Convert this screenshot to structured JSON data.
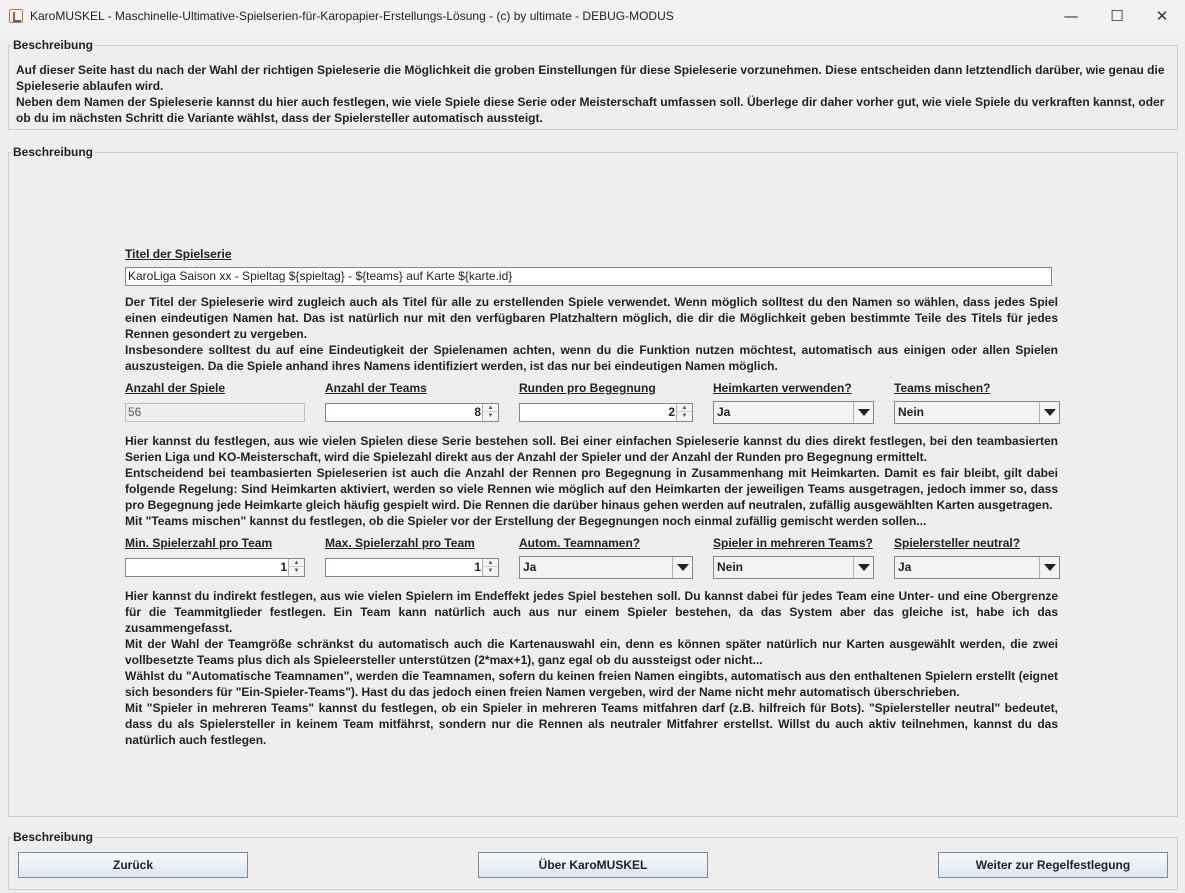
{
  "window": {
    "title": "KaroMUSKEL - Maschinelle-Ultimative-Spielserien-für-Karopapier-Erstellungs-Lösung - (c) by ultimate - DEBUG-MODUS",
    "min_glyph": "—",
    "max_glyph": "☐",
    "close_glyph": "✕"
  },
  "top_group": {
    "legend": "Beschreibung",
    "text": "Auf dieser Seite hast du nach der Wahl der richtigen Spieleserie die Möglichkeit die groben Einstellungen für diese Spieleserie vorzunehmen. Diese entscheiden dann letztendlich darüber, wie genau die Spieleserie ablaufen wird.\nNeben dem Namen der Spieleserie kannst du hier auch festlegen, wie viele Spiele diese Serie oder Meisterschaft umfassen soll. Überlege dir daher vorher gut, wie viele Spiele du verkraften kannst, oder ob du im nächsten Schritt die Variante wählst, dass der Spielersteller automatisch aussteigt."
  },
  "main_group": {
    "legend": "Beschreibung",
    "title_label": "Titel der Spielserie",
    "title_value": "KaroLiga Saison xx - Spieltag ${spieltag} - ${teams} auf Karte ${karte.id}",
    "title_desc": "Der Titel der Spieleserie wird zugleich auch als Titel für alle zu erstellenden Spiele verwendet. Wenn möglich solltest du den Namen so wählen, dass jedes Spiel einen eindeutigen Namen hat. Das ist natürlich nur mit den verfügbaren Platzhaltern möglich, die dir die Möglichkeit geben bestimmte Teile des Titels für jedes Rennen gesondert zu vergeben.\nInsbesondere solltest du auf eine Eindeutigkeit der Spielenamen achten, wenn du die Funktion nutzen möchtest, automatisch aus einigen oder allen Spielen auszusteigen. Da die Spiele anhand ihres Namens identifiziert werden, ist das nur bei eindeutigen Namen möglich.",
    "row1": {
      "games_label": "Anzahl der Spiele",
      "games_value": "56",
      "teams_label": "Anzahl der Teams",
      "teams_value": "8",
      "rounds_label": "Runden pro Begegnung",
      "rounds_value": "2",
      "home_label": "Heimkarten verwenden?",
      "home_value": "Ja",
      "shuffle_label": "Teams mischen?",
      "shuffle_value": "Nein"
    },
    "row1_desc": "Hier kannst du festlegen, aus wie vielen Spielen diese Serie bestehen soll. Bei einer einfachen Spieleserie kannst du dies direkt festlegen, bei den teambasierten Serien Liga und KO-Meisterschaft, wird die Spielezahl direkt aus der Anzahl der Spieler und der Anzahl der Runden pro Begegnung ermittelt.\nEntscheidend bei teambasierten Spieleserien ist auch die Anzahl der Rennen pro Begegnung in Zusammenhang mit Heimkarten. Damit es fair bleibt, gilt dabei folgende Regelung: Sind Heimkarten aktiviert, werden so viele Rennen wie möglich auf den Heimkarten der jeweiligen Teams ausgetragen, jedoch immer so, dass pro Begegnung jede Heimkarte gleich häufig gespielt wird. Die Rennen die darüber hinaus gehen werden auf neutralen, zufällig ausgewählten Karten ausgetragen.\nMit \"Teams mischen\" kannst du festlegen, ob die Spieler vor der Erstellung der Begegnungen noch einmal zufällig gemischt werden sollen...",
    "row2": {
      "min_label": "Min. Spielerzahl pro Team",
      "min_value": "1",
      "max_label": "Max. Spielerzahl pro Team",
      "max_value": "1",
      "autonames_label": "Autom. Teamnamen?",
      "autonames_value": "Ja",
      "multi_label": "Spieler in mehreren Teams?",
      "multi_value": "Nein",
      "neutral_label": "Spielersteller neutral?",
      "neutral_value": "Ja"
    },
    "row2_desc": "Hier kannst du indirekt festlegen, aus wie vielen Spielern im Endeffekt jedes Spiel bestehen soll. Du kannst dabei für jedes Team eine Unter- und eine Obergrenze für die Teammitglieder festlegen. Ein Team kann natürlich auch aus nur einem Spieler bestehen, da das System aber das gleiche ist, habe ich das zusammengefasst.\nMit der Wahl der Teamgröße schränkst du automatisch auch die Kartenauswahl ein, denn es können später natürlich nur Karten ausgewählt werden, die zwei vollbesetzte Teams plus dich als Spieleersteller unterstützen (2*max+1), ganz egal ob du aussteigst oder nicht...\nWählst du \"Automatische Teamnamen\", werden die Teamnamen, sofern du keinen freien Namen eingibts, automatisch aus den enthaltenen Spielern erstellt (eignet sich besonders für \"Ein-Spieler-Teams\"). Hast du das jedoch einen freien Namen vergeben, wird der Name nicht mehr automatisch überschrieben.\nMit \"Spieler in mehreren Teams\" kannst du festlegen, ob ein Spieler in mehreren Teams mitfahren darf (z.B. hilfreich für Bots). \"Spielersteller neutral\" bedeutet, dass du als Spielersteller in keinem Team mitfährst, sondern nur die Rennen als neutraler Mitfahrer erstellst. Willst du auch aktiv teilnehmen, kannst du das natürlich auch festlegen."
  },
  "bottom_group": {
    "legend": "Beschreibung",
    "back_label": "Zurück",
    "about_label": "Über KaroMUSKEL",
    "next_label": "Weiter zur Regelfestlegung"
  }
}
